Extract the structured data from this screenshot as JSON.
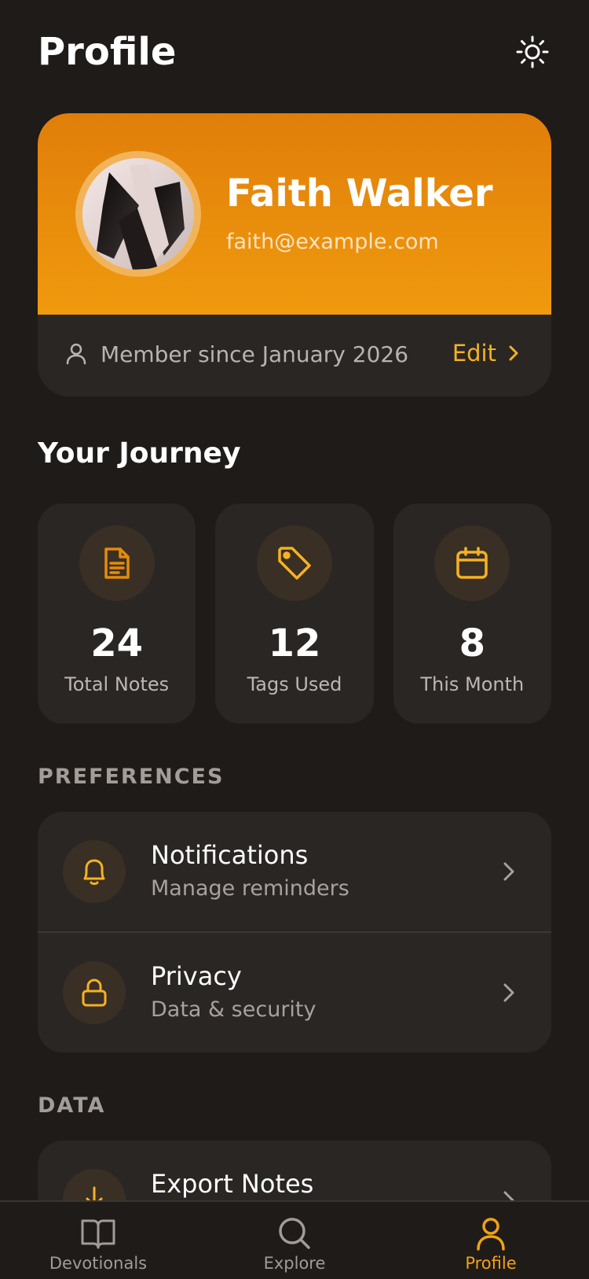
{
  "header": {
    "title": "Profile",
    "theme_icon": "sun-icon"
  },
  "profile": {
    "name": "Faith Walker",
    "email": "faith@example.com",
    "member_since": "Member since January 2026",
    "edit_label": "Edit"
  },
  "journey": {
    "title": "Your Journey",
    "stats": [
      {
        "icon": "document-icon",
        "value": "24",
        "label": "Total Notes"
      },
      {
        "icon": "tag-icon",
        "value": "12",
        "label": "Tags Used"
      },
      {
        "icon": "calendar-icon",
        "value": "8",
        "label": "This Month"
      }
    ]
  },
  "preferences": {
    "title": "PREFERENCES",
    "items": [
      {
        "icon": "bell-icon",
        "title": "Notifications",
        "subtitle": "Manage reminders"
      },
      {
        "icon": "lock-icon",
        "title": "Privacy",
        "subtitle": "Data & security"
      }
    ]
  },
  "data_section": {
    "title": "DATA",
    "items": [
      {
        "icon": "download-icon",
        "title": "Export Notes"
      }
    ]
  },
  "nav": [
    {
      "icon": "book-icon",
      "label": "Devotionals"
    },
    {
      "icon": "search-icon",
      "label": "Explore"
    },
    {
      "icon": "user-icon",
      "label": "Profile",
      "active": true
    }
  ],
  "colors": {
    "accent": "#f4b223",
    "orange": "#e68a0c",
    "background": "#1f1b19",
    "card": "#2a2624"
  }
}
